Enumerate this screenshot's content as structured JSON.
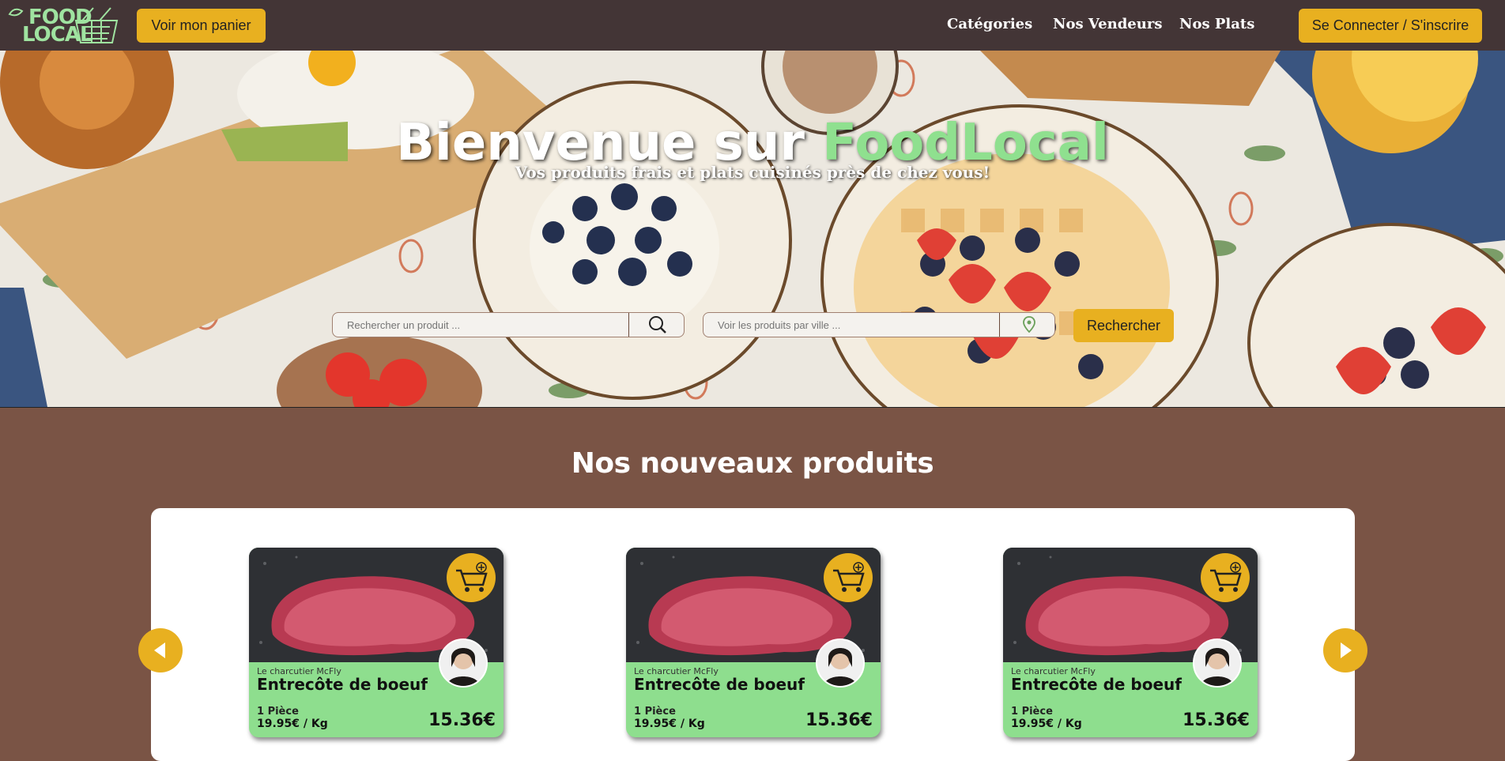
{
  "nav": {
    "logo_line1": "FOOD",
    "logo_line2": "LOCAL",
    "cart_label": "Voir mon panier",
    "links": [
      "Catégories",
      "Nos Vendeurs",
      "Nos Plats"
    ],
    "login_label": "Se Connecter / S'inscrire"
  },
  "hero": {
    "title_prefix": "Bienvenue sur ",
    "title_brand": "FoodLocal",
    "subtitle": "Vos produits frais et plats cuisinés près de chez vous!",
    "product_search_placeholder": "Rechercher un produit ...",
    "city_search_placeholder": "Voir les produits par ville ...",
    "search_button": "Rechercher"
  },
  "section": {
    "title": "Nos nouveaux produits"
  },
  "products": [
    {
      "vendor": "Le charcutier McFly",
      "name": "Entrecôte de boeuf",
      "quantity": "1 Pièce",
      "unit_price": "19.95€ / Kg",
      "price": "15.36€"
    },
    {
      "vendor": "Le charcutier McFly",
      "name": "Entrecôte de boeuf",
      "quantity": "1 Pièce",
      "unit_price": "19.95€ / Kg",
      "price": "15.36€"
    },
    {
      "vendor": "Le charcutier McFly",
      "name": "Entrecôte de boeuf",
      "quantity": "1 Pièce",
      "unit_price": "19.95€ / Kg",
      "price": "15.36€"
    }
  ],
  "icons": {
    "search": "search-icon",
    "location": "location-pin-icon",
    "cart_add": "cart-add-icon",
    "prev": "arrow-left-icon",
    "next": "arrow-right-icon"
  },
  "colors": {
    "navbar": "#433536",
    "accent": "#e8b020",
    "brand_green": "#8fe08f",
    "section_bg": "#7a5445",
    "card_info": "#8ede8e"
  }
}
